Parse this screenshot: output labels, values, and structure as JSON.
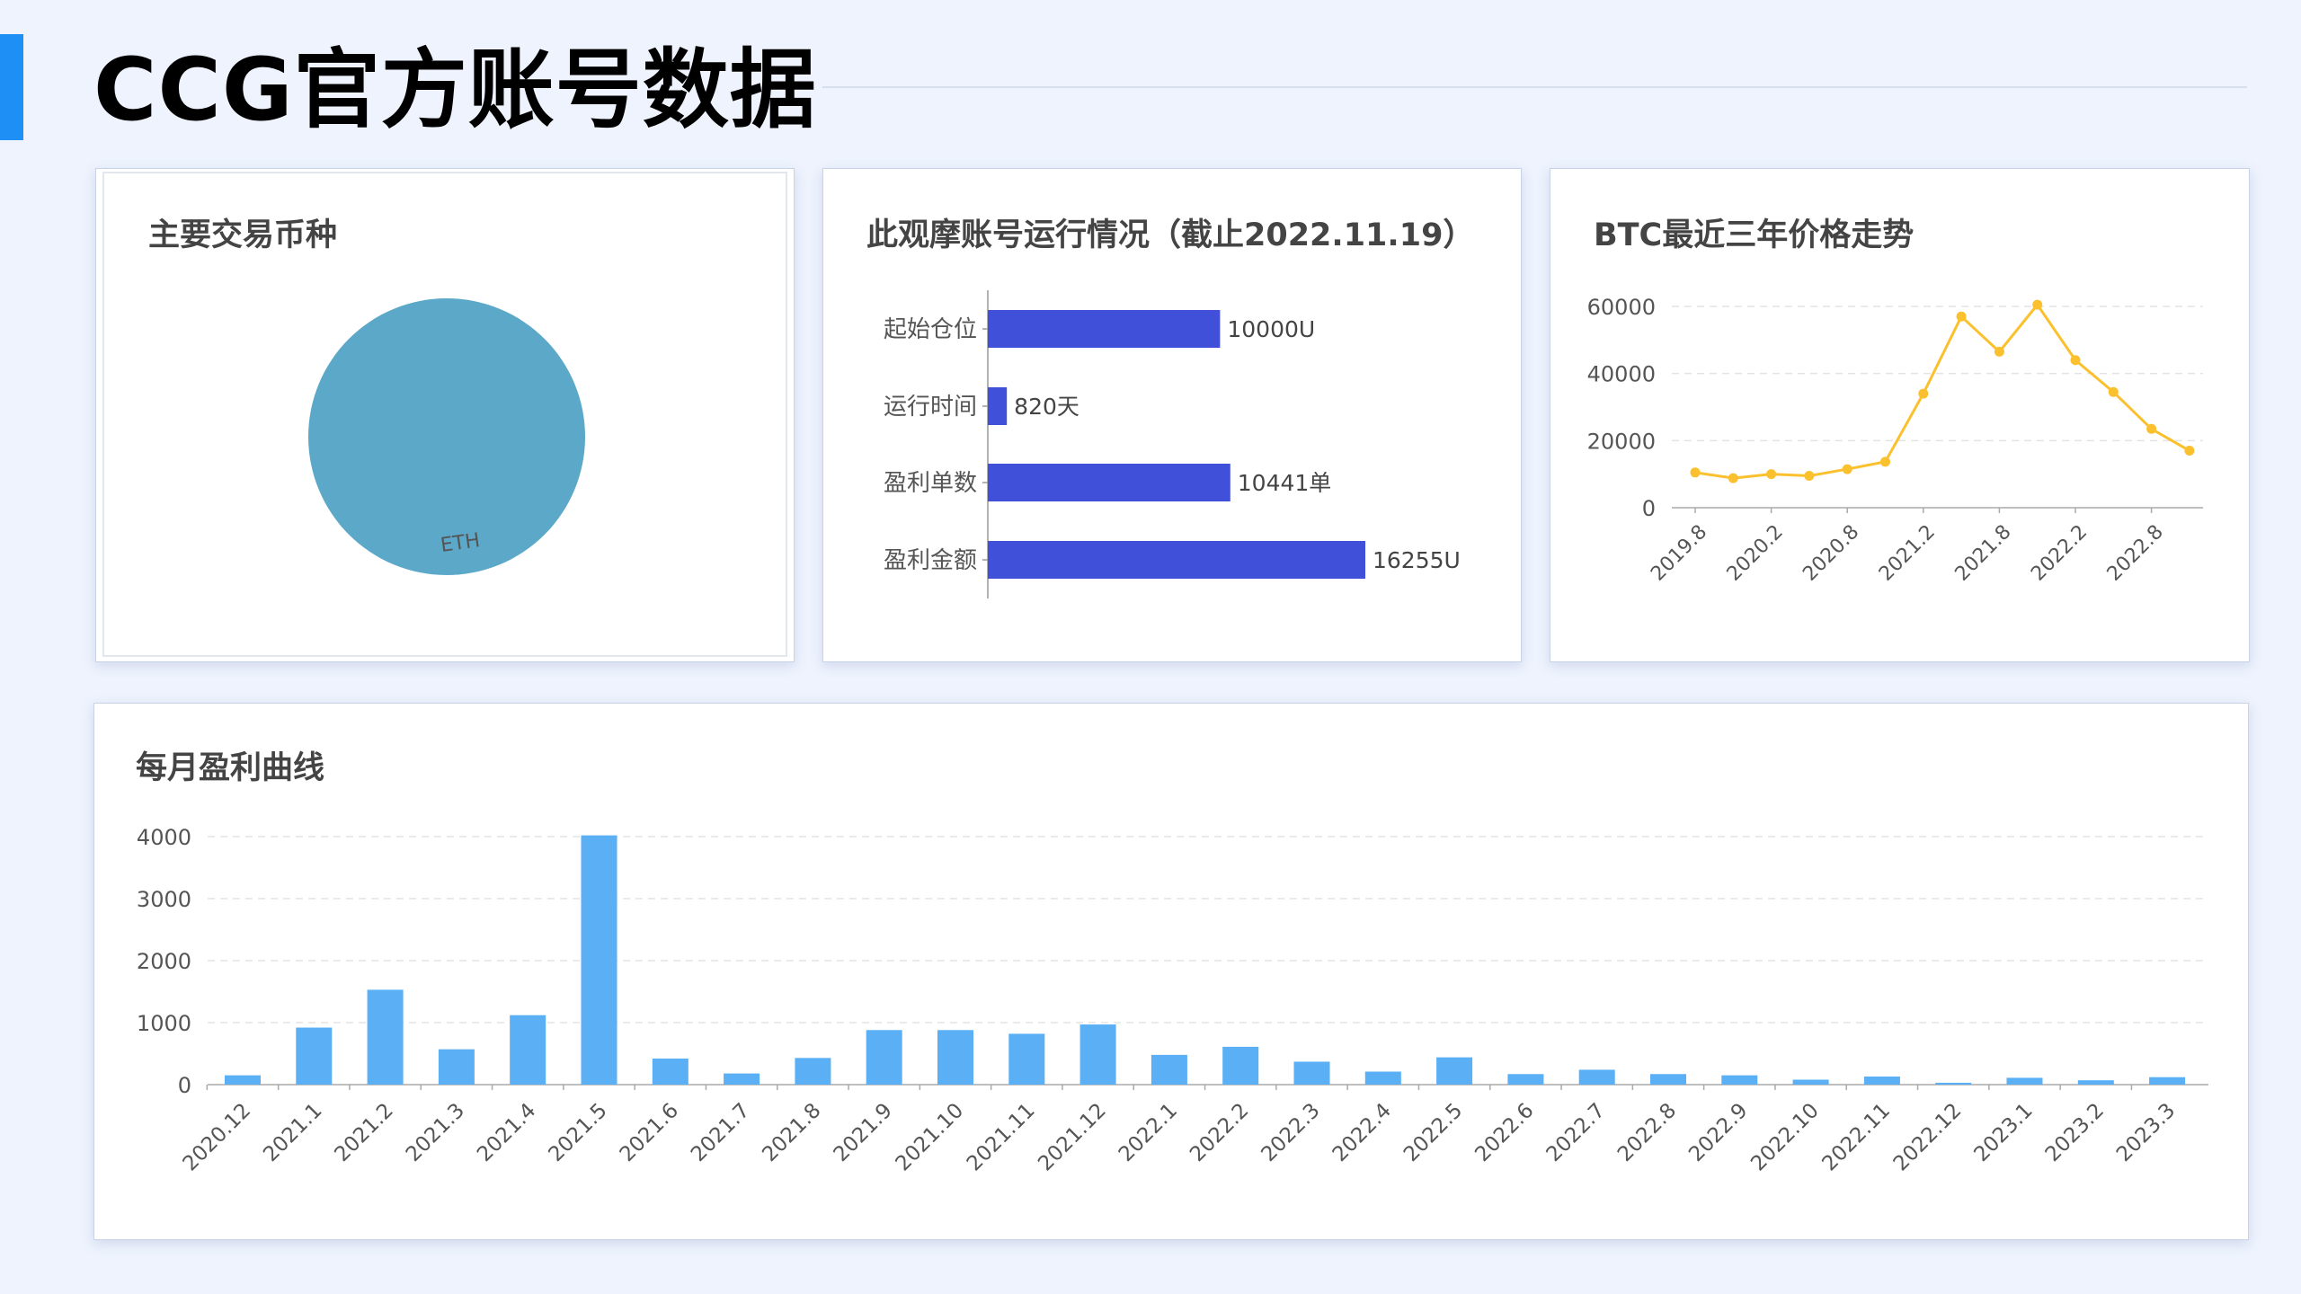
{
  "page": {
    "title": "CCG官方账号数据"
  },
  "colors": {
    "accent": "#1e90f5",
    "pie": "#5ca8c9",
    "hbar": "#4150d8",
    "line": "#fbc02d",
    "monthly_bar": "#5aaff5"
  },
  "chart_data": [
    {
      "type": "pie",
      "title": "主要交易币种",
      "labels": [
        "ETH"
      ],
      "values": [
        100
      ]
    },
    {
      "type": "bar",
      "orientation": "horizontal",
      "title": "此观摩账号运行情况（截止2022.11.19）",
      "categories": [
        "起始仓位",
        "运行时间",
        "盈利单数",
        "盈利金额"
      ],
      "values": [
        10000,
        820,
        10441,
        16255
      ],
      "value_labels": [
        "10000U",
        "820天",
        "10441单",
        "16255U"
      ]
    },
    {
      "type": "line",
      "title": "BTC最近三年价格走势",
      "x": [
        "2019.8",
        "2019.11",
        "2020.2",
        "2020.5",
        "2020.8",
        "2020.11",
        "2021.2",
        "2021.5",
        "2021.8",
        "2021.11",
        "2022.2",
        "2022.5",
        "2022.8",
        "2022.11"
      ],
      "x_tick_labels": [
        "2019.8",
        "2020.2",
        "2020.8",
        "2021.2",
        "2021.8",
        "2022.2",
        "2022.8"
      ],
      "values": [
        10500,
        8800,
        10000,
        9500,
        11500,
        13700,
        34000,
        57000,
        46500,
        60500,
        44000,
        34500,
        23500,
        17000
      ],
      "y_ticks": [
        0,
        20000,
        40000,
        60000
      ],
      "ylim": [
        0,
        60000
      ],
      "grid": true
    },
    {
      "type": "bar",
      "title": "每月盈利曲线",
      "categories": [
        "2020.12",
        "2021.1",
        "2021.2",
        "2021.3",
        "2021.4",
        "2021.5",
        "2021.6",
        "2021.7",
        "2021.8",
        "2021.9",
        "2021.10",
        "2021.11",
        "2021.12",
        "2022.1",
        "2022.2",
        "2022.3",
        "2022.4",
        "2022.5",
        "2022.6",
        "2022.7",
        "2022.8",
        "2022.9",
        "2022.10",
        "2022.11",
        "2022.12",
        "2023.1",
        "2023.2",
        "2023.3"
      ],
      "values": [
        150,
        920,
        1530,
        570,
        1120,
        4020,
        420,
        180,
        430,
        880,
        880,
        820,
        970,
        480,
        610,
        370,
        210,
        440,
        170,
        240,
        170,
        150,
        80,
        130,
        30,
        110,
        70,
        120
      ],
      "y_ticks": [
        0,
        1000,
        2000,
        3000,
        4000
      ],
      "ylim": [
        0,
        4000
      ],
      "grid": true
    }
  ]
}
